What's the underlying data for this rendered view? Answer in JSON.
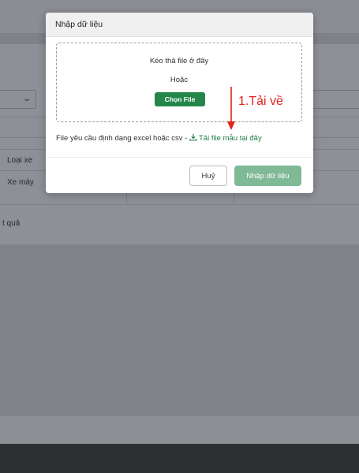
{
  "background": {
    "table": {
      "header_col": "Loại xe",
      "row_value": "Xe máy"
    },
    "result_text": "t quả"
  },
  "modal": {
    "title": "Nhập dữ liệu",
    "dropzone": {
      "drag_hint": "Kéo thả file ở đây",
      "or_text": "Hoặc",
      "choose_button": "Chọn File"
    },
    "requirement_text": "File yêu cầu định dạng excel hoặc csv - ",
    "download_link": "Tải file mẫu tại đây",
    "cancel_button": "Huỷ",
    "import_button": "Nhập dữ liệu"
  },
  "annotation": {
    "label": "1.Tải về",
    "color": "#e2231a"
  },
  "colors": {
    "primary_green": "#24864a",
    "disabled_green": "#80b996",
    "link_green": "#1f7a42"
  },
  "icons": {
    "download": "download-icon",
    "dropdown": "chevron-down-icon",
    "annotation_arrow": "arrow-down-icon"
  }
}
